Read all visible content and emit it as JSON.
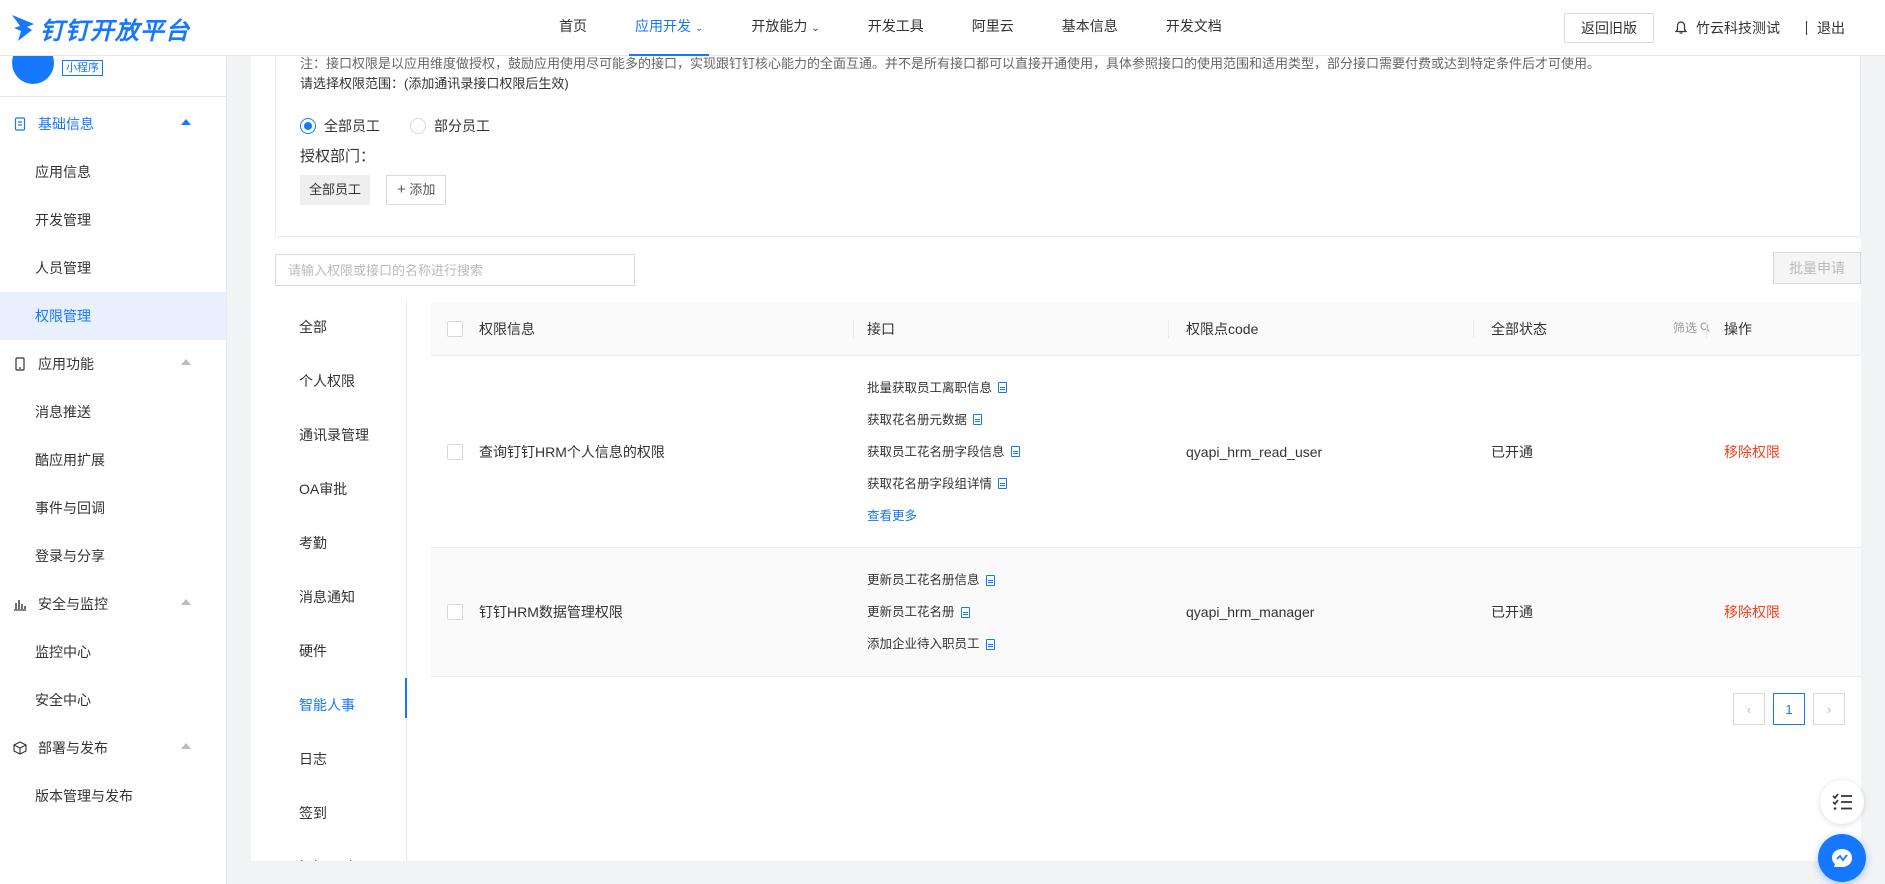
{
  "brand": {
    "name": "钉钉开放平台",
    "accent": "#1677ff"
  },
  "nav": {
    "items": [
      {
        "label": "首页"
      },
      {
        "label": "应用开发",
        "active": true,
        "dropdown": true
      },
      {
        "label": "开放能力",
        "dropdown": true
      },
      {
        "label": "开发工具"
      },
      {
        "label": "阿里云"
      },
      {
        "label": "基本信息"
      },
      {
        "label": "开发文档"
      }
    ],
    "old_version_label": "返回旧版",
    "org_name": "竹云科技测试",
    "logout_label": "退出"
  },
  "sidebar": {
    "app_tag": "小程序",
    "groups": [
      {
        "label": "基础信息",
        "icon": "doc-icon",
        "open": true,
        "items": [
          {
            "label": "应用信息"
          },
          {
            "label": "开发管理"
          },
          {
            "label": "人员管理"
          },
          {
            "label": "权限管理",
            "active": true
          }
        ]
      },
      {
        "label": "应用功能",
        "icon": "phone-icon",
        "items": [
          {
            "label": "消息推送"
          },
          {
            "label": "酷应用扩展"
          },
          {
            "label": "事件与回调"
          },
          {
            "label": "登录与分享"
          }
        ]
      },
      {
        "label": "安全与监控",
        "icon": "bar-chart-icon",
        "items": [
          {
            "label": "监控中心"
          },
          {
            "label": "安全中心"
          }
        ]
      },
      {
        "label": "部署与发布",
        "icon": "cube-icon",
        "items": [
          {
            "label": "版本管理与发布"
          }
        ]
      }
    ]
  },
  "scope": {
    "note": "注：接口权限是以应用维度做授权，鼓励应用使用尽可能多的接口，实现跟钉钉核心能力的全面互通。并不是所有接口都可以直接开通使用，具体参照接口的使用范围和适用类型，部分接口需要付费或达到特定条件后才可使用。",
    "label": "请选择权限范围：(添加通讯录接口权限后生效)",
    "options": [
      {
        "label": "全部员工",
        "checked": true
      },
      {
        "label": "部分员工",
        "checked": false
      }
    ],
    "dept_label": "授权部门：",
    "dept_tag": "全部员工",
    "add_label": "添加"
  },
  "search": {
    "placeholder": "请输入权限或接口的名称进行搜索"
  },
  "batch_label": "批量申请",
  "categories": [
    {
      "label": "全部"
    },
    {
      "label": "个人权限"
    },
    {
      "label": "通讯录管理"
    },
    {
      "label": "OA审批"
    },
    {
      "label": "考勤"
    },
    {
      "label": "消息通知"
    },
    {
      "label": "硬件"
    },
    {
      "label": "智能人事",
      "active": true
    },
    {
      "label": "日志"
    },
    {
      "label": "签到"
    },
    {
      "label": "钉钉运动"
    }
  ],
  "table": {
    "headers": {
      "info": "权限信息",
      "api": "接口",
      "code": "权限点code",
      "status": "全部状态",
      "filter": "筛选",
      "op": "操作"
    },
    "rows": [
      {
        "info": "查询钉钉HRM个人信息的权限",
        "apis": [
          "批量获取员工离职信息",
          "获取花名册元数据",
          "获取员工花名册字段信息",
          "获取花名册字段组详情"
        ],
        "more": "查看更多",
        "code": "qyapi_hrm_read_user",
        "status": "已开通",
        "op": "移除权限"
      },
      {
        "info": "钉钉HRM数据管理权限",
        "apis": [
          "更新员工花名册信息",
          "更新员工花名册",
          "添加企业待入职员工"
        ],
        "code": "qyapi_hrm_manager",
        "status": "已开通",
        "op": "移除权限"
      }
    ]
  },
  "pagination": {
    "current": "1"
  }
}
